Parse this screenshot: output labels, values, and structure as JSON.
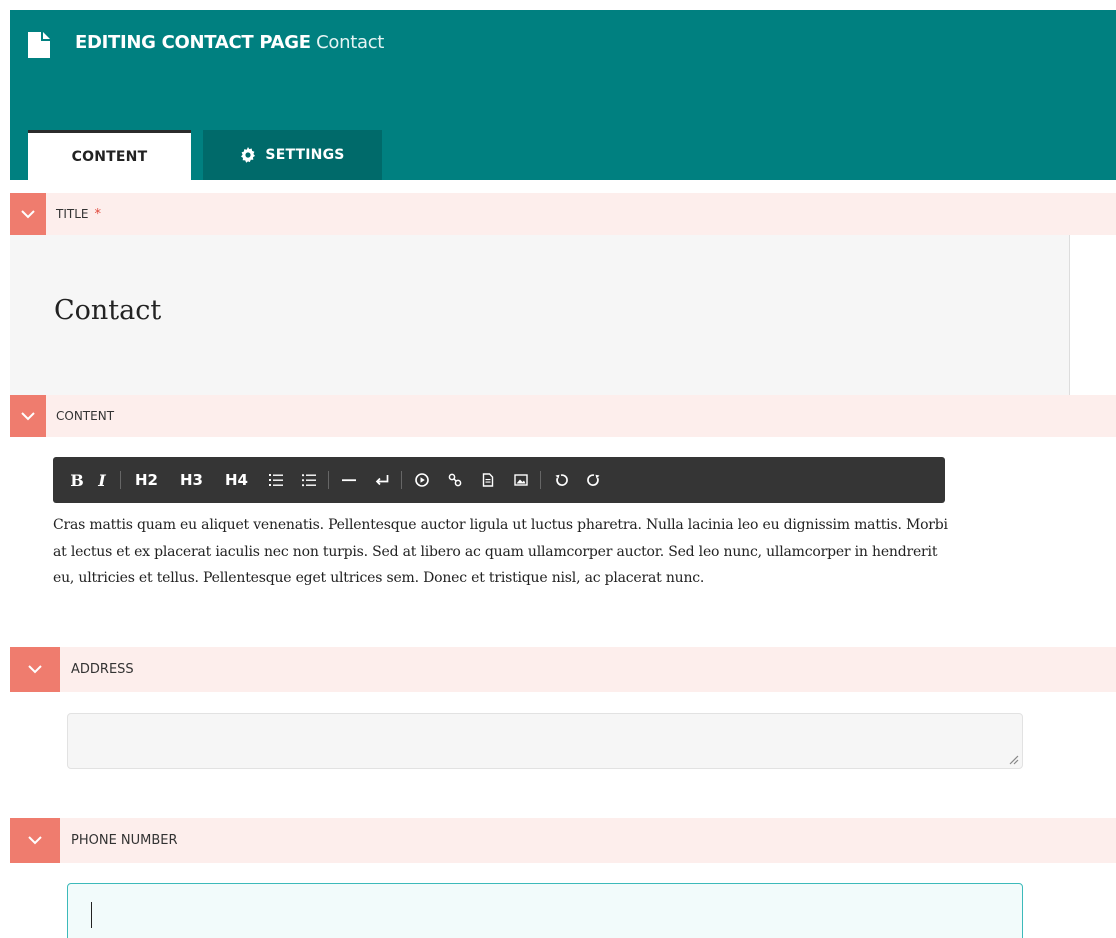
{
  "header": {
    "title_bold": "EDITING CONTACT PAGE",
    "title_light": "Contact",
    "icon": "document-icon",
    "bg_color": "#008080"
  },
  "tabs": [
    {
      "label": "CONTENT",
      "active": true
    },
    {
      "label": "SETTINGS",
      "active": false,
      "icon": "gear-icon"
    }
  ],
  "fields": {
    "title": {
      "label": "TITLE",
      "required_marker": "*",
      "value": "Contact"
    },
    "content": {
      "label": "CONTENT",
      "toolbar": {
        "bold": "B",
        "italic": "I",
        "h2": "H2",
        "h3": "H3",
        "h4": "H4",
        "icons": [
          "ordered-list-icon",
          "unordered-list-icon",
          "horizontal-rule-icon",
          "line-break-icon",
          "embed-video-icon",
          "link-icon",
          "file-icon",
          "image-icon",
          "undo-icon",
          "redo-icon"
        ]
      },
      "body": "Cras mattis quam eu aliquet venenatis. Pellentesque auctor ligula ut luctus pharetra. Nulla lacinia leo eu dignissim mattis. Morbi at lectus et ex placerat iaculis nec non turpis. Sed at libero ac quam ullamcorper auctor. Sed leo nunc, ullamcorper in hendrerit eu, ultricies et tellus. Pellentesque eget ultrices sem. Donec et tristique nisl, ac placerat nunc."
    },
    "address": {
      "label": "ADDRESS",
      "value": ""
    },
    "phone": {
      "label": "PHONE NUMBER",
      "value": ""
    }
  },
  "colors": {
    "accent": "#008080",
    "section_bar": "#fdeeec",
    "chevron_bg": "#ef7c6e",
    "required": "#e0473a"
  }
}
